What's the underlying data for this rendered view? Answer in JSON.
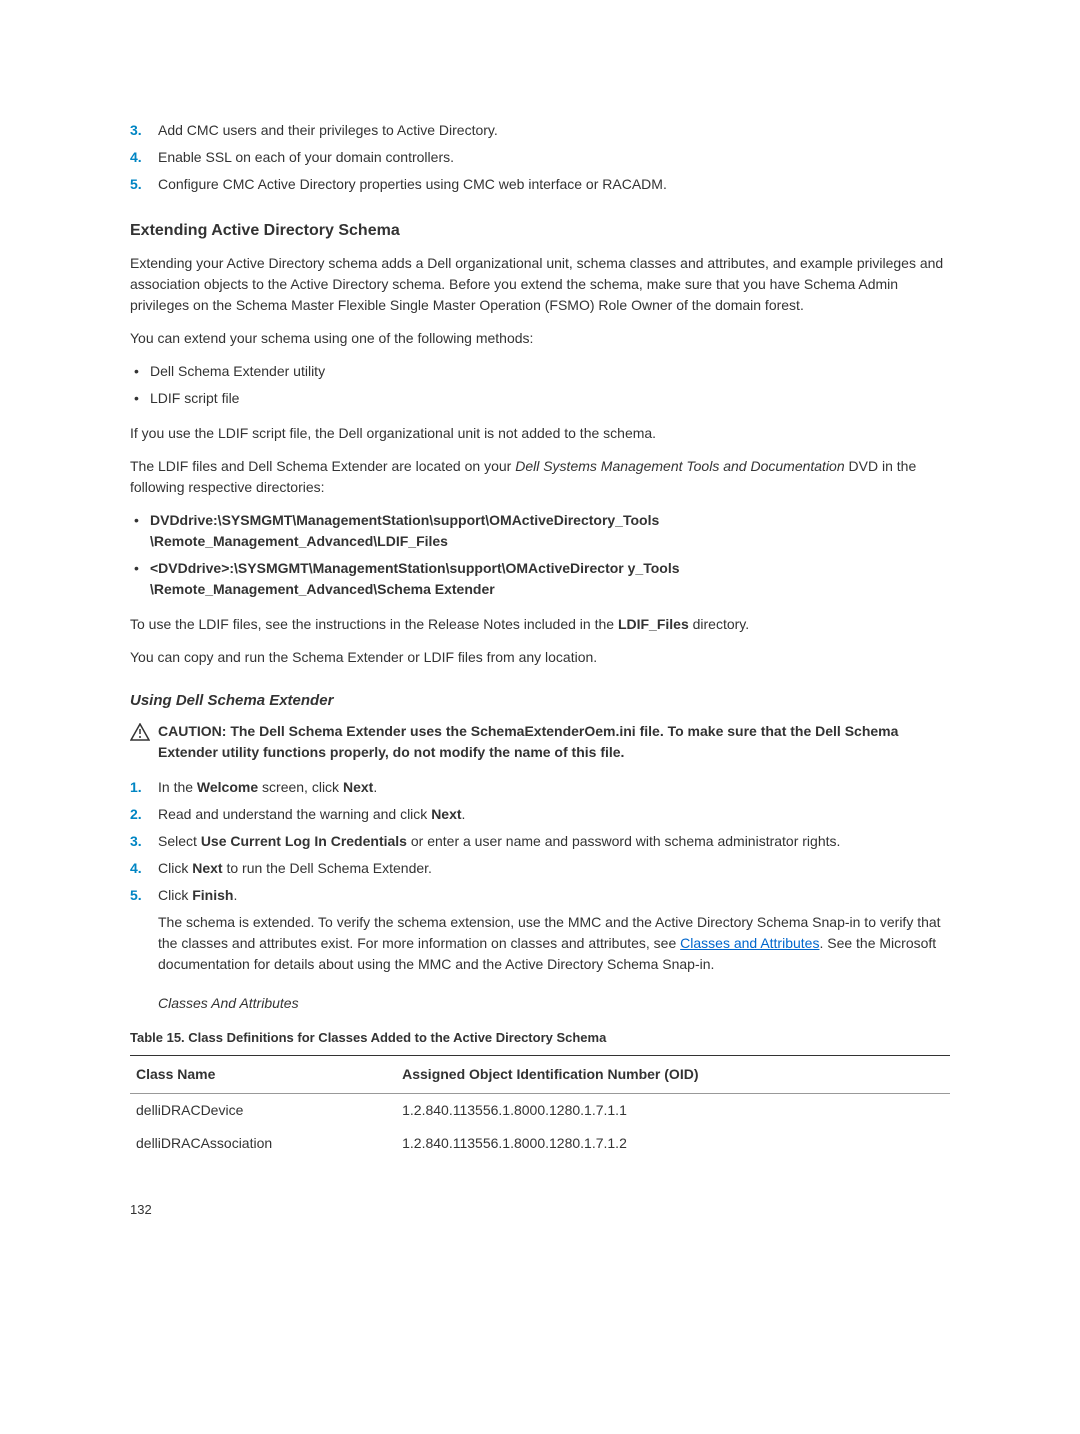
{
  "topList": {
    "item3": "Add CMC users and their privileges to Active Directory.",
    "item4": "Enable SSL on each of your domain controllers.",
    "item5": "Configure CMC Active Directory properties using CMC web interface or RACADM."
  },
  "sectionTitle": "Extending Active Directory Schema",
  "para1": "Extending your Active Directory schema adds a Dell organizational unit, schema classes and attributes, and example privileges and association objects to the Active Directory schema. Before you extend the schema, make sure that you have Schema Admin privileges on the Schema Master Flexible Single Master Operation (FSMO) Role Owner of the domain forest.",
  "para2": "You can extend your schema using one of the following methods:",
  "methodList": {
    "m1": "Dell Schema Extender utility",
    "m2": "LDIF script file"
  },
  "para3": "If you use the LDIF script file, the Dell organizational unit is not added to the schema.",
  "para4_pre": "The LDIF files and Dell Schema Extender are located on your ",
  "para4_italic": "Dell Systems Management Tools and Documentation",
  "para4_post": " DVD in the following respective directories:",
  "pathList": {
    "p1": "DVDdrive:\\SYSMGMT\\ManagementStation\\support\\OMActiveDirectory_Tools \\Remote_Management_Advanced\\LDIF_Files",
    "p2": "<DVDdrive>:\\SYSMGMT\\ManagementStation\\support\\OMActiveDirector y_Tools \\Remote_Management_Advanced\\Schema Extender"
  },
  "para5_pre": "To use the LDIF files, see the instructions in the Release Notes included in the ",
  "para5_bold": "LDIF_Files",
  "para5_post": " directory.",
  "para6": "You can copy and run the Schema Extender or LDIF files from any location.",
  "subSectionTitle": "Using Dell Schema Extender",
  "caution": "CAUTION: The Dell Schema Extender uses the SchemaExtenderOem.ini file. To make sure that the Dell Schema Extender utility functions properly, do not modify the name of this file.",
  "steps": {
    "s1_pre": "In the ",
    "s1_b1": "Welcome",
    "s1_mid": " screen, click ",
    "s1_b2": "Next",
    "s1_post": ".",
    "s2_pre": "Read and understand the warning and click ",
    "s2_b": "Next",
    "s2_post": ".",
    "s3_pre": "Select ",
    "s3_b": "Use Current Log In Credentials",
    "s3_post": " or enter a user name and password with schema administrator rights.",
    "s4_pre": "Click ",
    "s4_b": "Next",
    "s4_post": " to run the Dell Schema Extender.",
    "s5_pre": "Click ",
    "s5_b": "Finish",
    "s5_post": ".",
    "s5_para_pre": "The schema is extended. To verify the schema extension, use the MMC and the Active Directory Schema Snap-in to verify that the classes and attributes exist. For more information on classes and attributes, see ",
    "s5_link": "Classes and Attributes",
    "s5_para_post": ". See the Microsoft documentation for details about using the MMC and the Active Directory Schema Snap-in."
  },
  "attrTitle": "Classes And Attributes",
  "tableCaption": "Table 15. Class Definitions for Classes Added to the Active Directory Schema",
  "table": {
    "h1": "Class Name",
    "h2": "Assigned Object Identification Number (OID)",
    "r1c1": "delliDRACDevice",
    "r1c2": "1.2.840.113556.1.8000.1280.1.7.1.1",
    "r2c1": "delliDRACAssociation",
    "r2c2": "1.2.840.113556.1.8000.1280.1.7.1.2"
  },
  "pageNum": "132"
}
